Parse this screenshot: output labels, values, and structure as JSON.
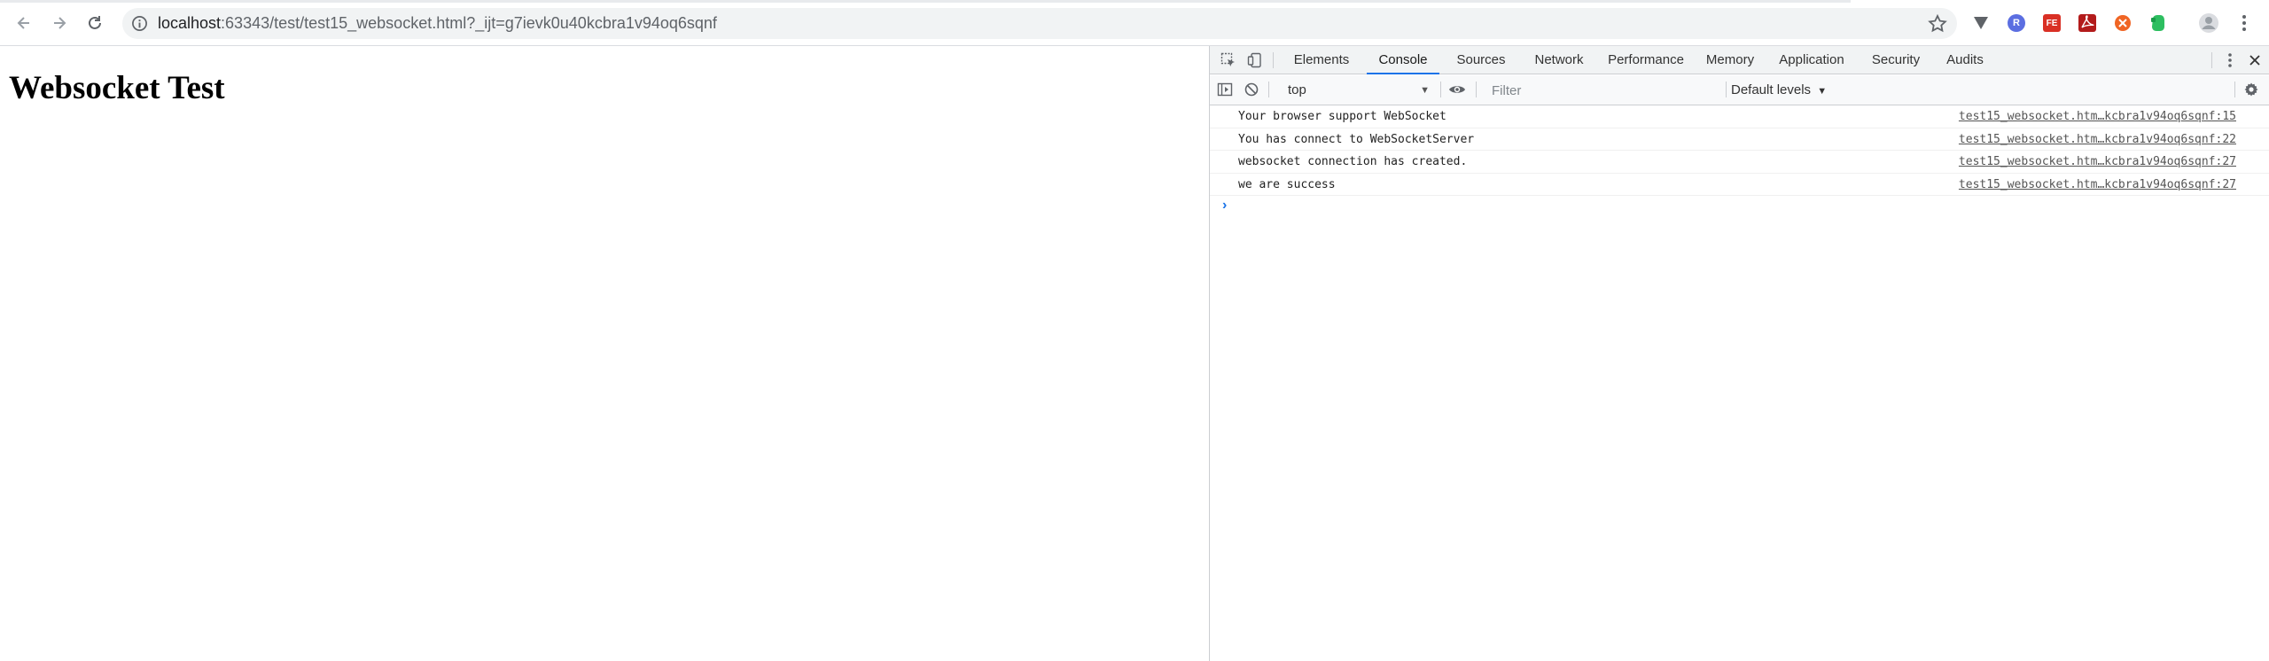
{
  "browser": {
    "url_host": "localhost",
    "url_rest": ":63343/test/test15_websocket.html?_ijt=g7ievk0u40kcbra1v94oq6sqnf",
    "nav_icons": [
      "back-arrow-icon",
      "forward-arrow-icon",
      "reload-icon"
    ],
    "extensions": [
      {
        "name": "vimium-icon",
        "color": "#5f6368",
        "label": ""
      },
      {
        "name": "react-devtools-icon",
        "color": "#5b6ee1",
        "label": "R"
      },
      {
        "name": "fe-helper-icon",
        "color": "#d93025",
        "label": "FE"
      },
      {
        "name": "pdf-icon",
        "color": "#b31b1b",
        "label": ""
      },
      {
        "name": "ublock-icon",
        "color": "#f06524",
        "label": ""
      },
      {
        "name": "evernote-icon",
        "color": "#2dbe60",
        "label": ""
      }
    ]
  },
  "page": {
    "heading": "Websocket Test"
  },
  "devtools": {
    "tabs": [
      {
        "label": "Elements",
        "active": false
      },
      {
        "label": "Console",
        "active": true
      },
      {
        "label": "Sources",
        "active": false
      },
      {
        "label": "Network",
        "active": false
      },
      {
        "label": "Performance",
        "active": false
      },
      {
        "label": "Memory",
        "active": false
      },
      {
        "label": "Application",
        "active": false
      },
      {
        "label": "Security",
        "active": false
      },
      {
        "label": "Audits",
        "active": false
      }
    ],
    "context": "top",
    "filter_placeholder": "Filter",
    "levels": "Default levels",
    "messages": [
      {
        "text": "Your browser support WebSocket",
        "source": "test15_websocket.htm…kcbra1v94oq6sqnf:15"
      },
      {
        "text": "You has connect to WebSocketServer",
        "source": "test15_websocket.htm…kcbra1v94oq6sqnf:22"
      },
      {
        "text": "websocket connection has created.",
        "source": "test15_websocket.htm…kcbra1v94oq6sqnf:27"
      },
      {
        "text": "we are success",
        "source": "test15_websocket.htm…kcbra1v94oq6sqnf:27"
      }
    ],
    "accent_color": "#1a73e8"
  }
}
